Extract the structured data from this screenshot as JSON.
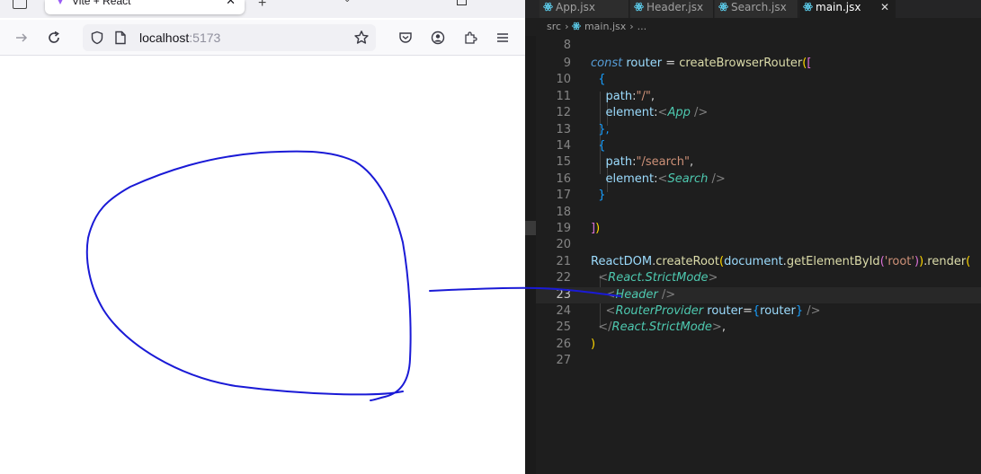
{
  "browser": {
    "tab_title": "Vite + React",
    "url_host": "localhost",
    "url_port": ":5173"
  },
  "editor": {
    "tabs": [
      {
        "label": "App.jsx"
      },
      {
        "label": "Header.jsx"
      },
      {
        "label": "Search.jsx"
      },
      {
        "label": "main.jsx"
      }
    ],
    "breadcrumb": {
      "folder": "src",
      "file": "main.jsx",
      "more": "..."
    },
    "current_line": 23,
    "line_numbers": [
      "8",
      "9",
      "10",
      "11",
      "12",
      "13",
      "14",
      "15",
      "16",
      "17",
      "18",
      "19",
      "20",
      "21",
      "22",
      "23",
      "24",
      "25",
      "26",
      "27"
    ],
    "code": {
      "l9": {
        "kw": "const",
        "name": "router",
        "eq": "=",
        "fn": "createBrowserRouter",
        "open": "([",
        "open_paren": "(",
        "open_brack": "["
      },
      "l10": "{",
      "l11": {
        "prop": "path",
        "colon": ":",
        "val": "\"/\"",
        "comma": ","
      },
      "l12": {
        "prop": "element",
        "colon": ":",
        "lt": "<",
        "tag": "App",
        "close": " />"
      },
      "l13": "},",
      "l14": "{",
      "l15": {
        "prop": "path",
        "colon": ":",
        "val": "\"/search\"",
        "comma": ","
      },
      "l16": {
        "prop": "element",
        "colon": ":",
        "lt": "<",
        "tag": "Search",
        "close": " />"
      },
      "l17": "}",
      "l19": {
        "close_brack": "]",
        "close_paren": ")"
      },
      "l21": {
        "obj": "ReactDOM",
        "dot": ".",
        "fn": "createRoot",
        "p1": "(",
        "doc": "document",
        "dot2": ".",
        "fn2": "getElementById",
        "p2": "(",
        "str": "'root'",
        "p2c": ")",
        "p1c": ")",
        "dot3": ".",
        "fn3": "render",
        "p3": "("
      },
      "l22": {
        "lt": "<",
        "tag": "React.StrictMode",
        "gt": ">"
      },
      "l23": {
        "lt": "<",
        "tag": "Header",
        "close": " />"
      },
      "l24": {
        "lt": "<",
        "tag": "RouterProvider",
        "attr": "router",
        "eq": "=",
        "lb": "{",
        "val": "router",
        "rb": "}",
        "close": " />"
      },
      "l25": {
        "lt": "</",
        "tag": "React.StrictMode",
        "gt": ">",
        "comma": ","
      },
      "l26": ")"
    }
  },
  "colors": {
    "editor_bg": "#1e1e1e",
    "annotation_stroke": "#1a1ad6"
  },
  "icons": [
    "tab-list-icon",
    "vite-favicon",
    "close-icon",
    "plus-icon",
    "chevron-down-icon",
    "maximize-icon",
    "forward-icon",
    "reload-icon",
    "shield-icon",
    "page-icon",
    "star-icon",
    "pocket-icon",
    "account-icon",
    "extensions-icon",
    "menu-icon",
    "react-icon"
  ]
}
